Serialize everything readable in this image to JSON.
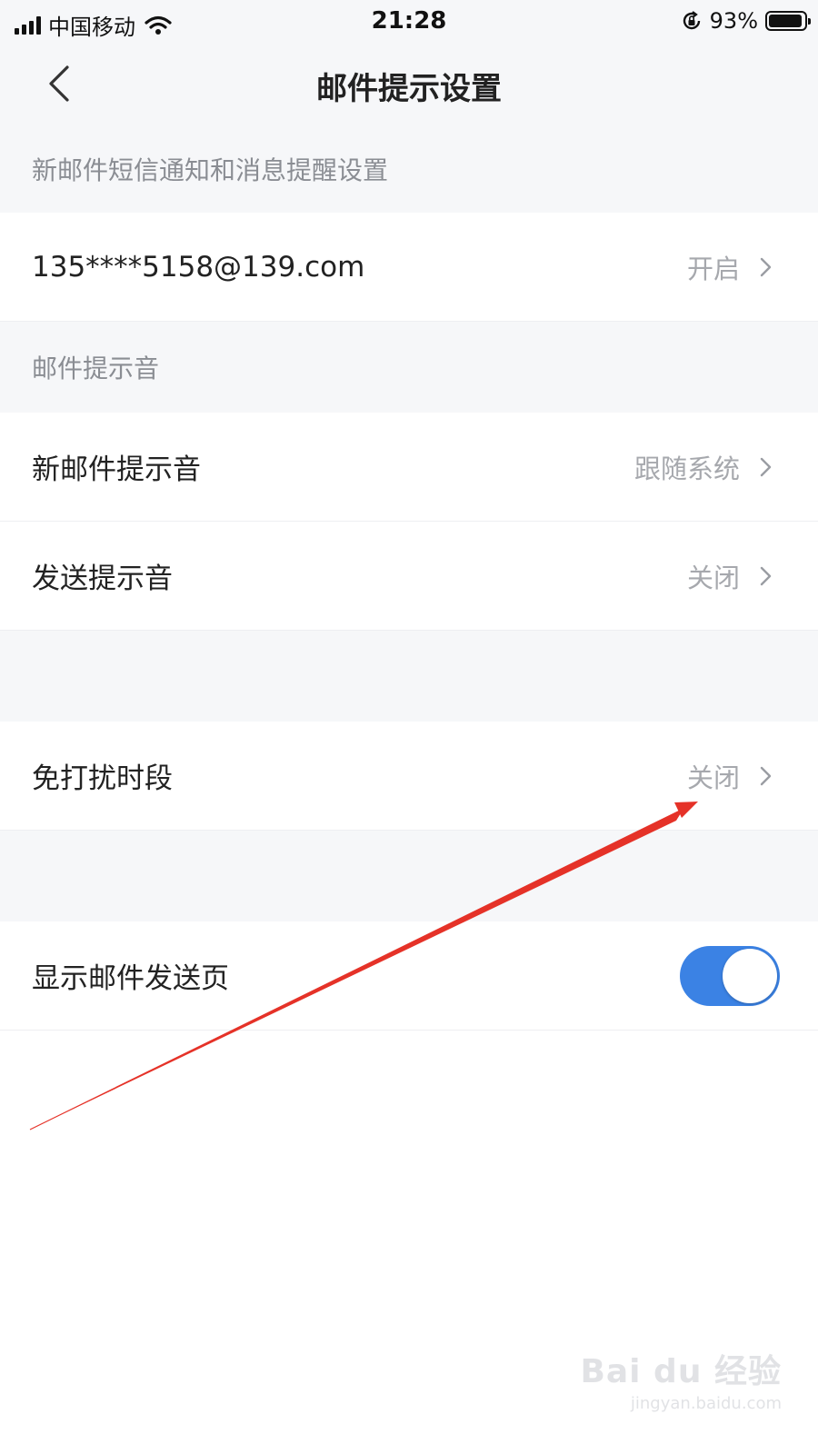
{
  "status_bar": {
    "carrier": "中国移动",
    "time": "21:28",
    "battery": "93%"
  },
  "nav": {
    "title": "邮件提示设置"
  },
  "sections": {
    "sms_header": "新邮件短信通知和消息提醒设置",
    "sound_header": "邮件提示音"
  },
  "rows": {
    "account": {
      "label": "135****5158@139.com",
      "value": "开启"
    },
    "new_mail_sound": {
      "label": "新邮件提示音",
      "value": "跟随系统"
    },
    "send_sound": {
      "label": "发送提示音",
      "value": "关闭"
    },
    "dnd": {
      "label": "免打扰时段",
      "value": "关闭"
    },
    "show_send_page": {
      "label": "显示邮件发送页",
      "toggle_on": true
    }
  },
  "colors": {
    "accent": "#3b82e4",
    "annotation_arrow": "#e53228"
  },
  "icons": {
    "back": "chevron-left-icon",
    "row_arrow": "chevron-right-icon",
    "signal": "signal-icon",
    "wifi": "wifi-icon",
    "orientation_lock": "orientation-lock-icon",
    "battery": "battery-icon"
  },
  "watermark": {
    "main": "Bai du 经验",
    "sub": "jingyan.baidu.com"
  }
}
